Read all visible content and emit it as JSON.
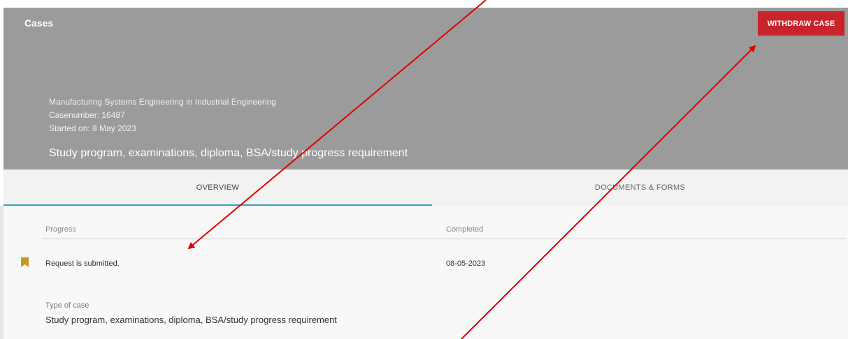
{
  "header": {
    "title": "Cases",
    "withdraw_label": "WITHDRAW CASE",
    "program": "Manufacturing Systems Engineering in Industrial Engineering",
    "case_number": "Casenumber: 16487",
    "started_on": "Started on: 8 May 2023",
    "subject": "Study program, examinations, diploma, BSA/study progress requirement"
  },
  "tabs": {
    "overview": "OVERVIEW",
    "documents": "DOCUMENTS & FORMS"
  },
  "progress": {
    "col_progress": "Progress",
    "col_completed": "Completed",
    "rows": [
      {
        "step": "Request is submitted.",
        "completed": "08-05-2023",
        "icon": "bookmark-icon"
      }
    ]
  },
  "case_type": {
    "label": "Type of case",
    "value": "Study program, examinations, diploma, BSA/study progress requirement"
  },
  "colors": {
    "header_bg": "#9b9b9b",
    "withdraw_bg": "#c9242b",
    "tab_indicator": "#3aa0c8",
    "bookmark": "#c79a1e",
    "annotation_arrow": "#e00000"
  }
}
